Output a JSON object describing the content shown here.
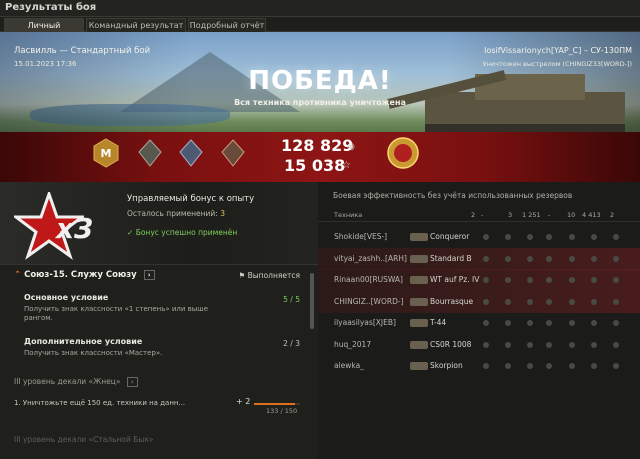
{
  "window": {
    "title": "Результаты боя"
  },
  "tabs": [
    "Личный результат",
    "Командный результат",
    "Подробный отчёт"
  ],
  "battle": {
    "map_mode": "Ласвилль — Стандартный бой",
    "date": "15.01.2023 17:36",
    "player": "IosifVissarionych[YAP_C] – СУ-130ПМ",
    "killed_by": "Уничтожен выстрелом (CHINGIZ33[WORD-])",
    "result": "ПОБЕДА!",
    "result_sub": "Вся техника противника уничтожена",
    "credits": "128 829",
    "xp": "15 038"
  },
  "bonus": {
    "multiplier": "x3",
    "title": "Управляемый бонус к опыту",
    "remaining_label": "Осталось применений:",
    "remaining_value": "3",
    "applied": "Бонус успешно применён"
  },
  "mission": {
    "title": "Союз-15. Служу Союзу",
    "status": "Выполняется",
    "main_condition": "Основное условие",
    "main_desc": "Получить знак классности «1 степень» или выше рангом.",
    "main_count": "5 / 5",
    "extra_condition": "Дополнительное условие",
    "extra_desc": "Получить знак классности «Мастер».",
    "extra_count": "2 / 3",
    "section": "III уровень декали «Жнец»",
    "task": "1. Уничтожьте ещё 150 ед. техники на данн...",
    "task_plus": "+ 2",
    "task_progress_label": "133 / 150",
    "task_progress": 0.887,
    "section2": "III уровень декали «Стальной Бык»"
  },
  "efficiency": {
    "title": "Боевая эффективность без учёта использованных резервов",
    "col_vehicle": "Техника",
    "col_nums": [
      "2",
      "-",
      "3",
      "1 251",
      "-",
      "10",
      "4 413",
      "2"
    ],
    "rows": [
      {
        "player": "Shokide[VES-]",
        "tank": "Conqueror"
      },
      {
        "player": "vityai_zashh..[ARH]",
        "tank": "Standard B"
      },
      {
        "player": "Rinaan00[RUSWA]",
        "tank": "WT auf Pz. IV"
      },
      {
        "player": "CHINGIZ..[WORD-]",
        "tank": "Bourrasque"
      },
      {
        "player": "ilyaasilyas[XJEB]",
        "tank": "T-44"
      },
      {
        "player": "huq_2017",
        "tank": "CS0R 1008"
      },
      {
        "player": "alewka_",
        "tank": "Skorpion"
      }
    ]
  },
  "colors": {
    "victory_band": "#8d1515",
    "accent_green": "#7fcf5c",
    "bg": "#1b1b19"
  }
}
